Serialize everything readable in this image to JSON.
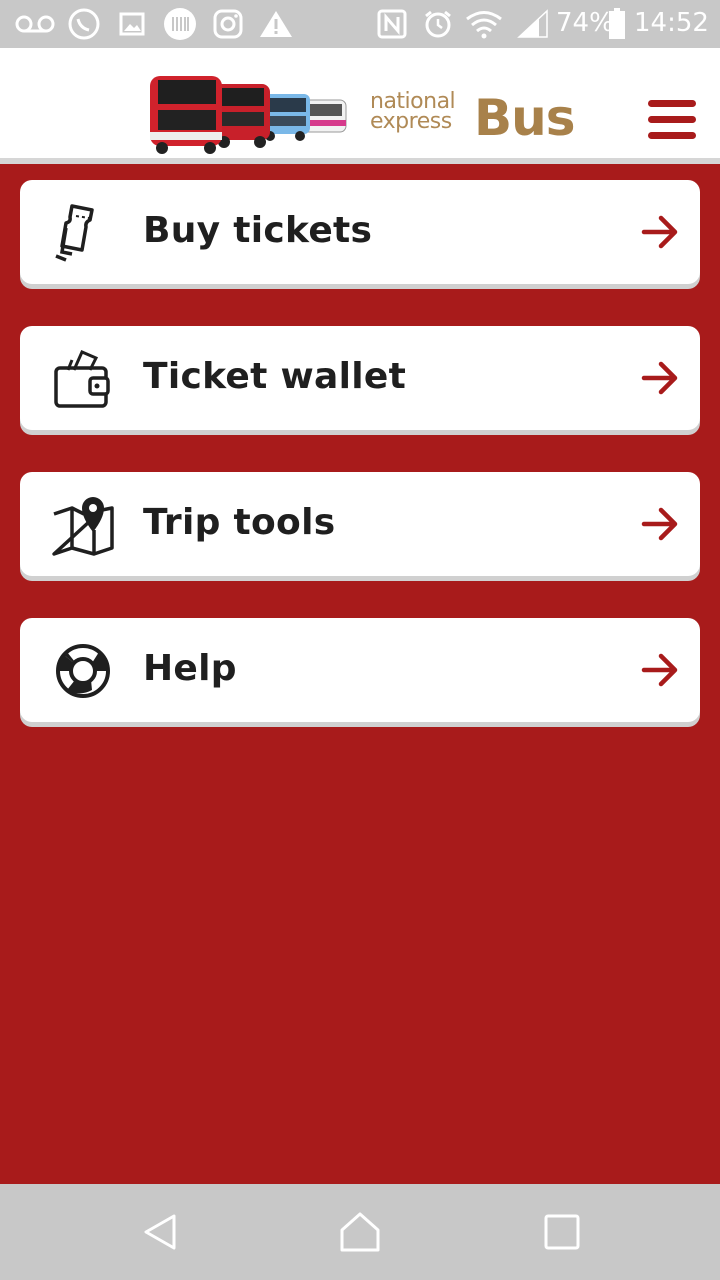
{
  "status_bar": {
    "battery_percent": "74%",
    "time": "14:52",
    "icons": [
      "voicemail-icon",
      "whatsapp-icon",
      "image-icon",
      "barcode-icon",
      "instagram-icon",
      "warning-icon",
      "nfc-icon",
      "alarm-icon",
      "wifi-icon",
      "signal-icon",
      "battery-icon"
    ]
  },
  "header": {
    "logo_line1": "national",
    "logo_line2": "express",
    "logo_bus": "Bus",
    "brand_color": "#a81b1b",
    "logo_gold": "#a8814a"
  },
  "menu": {
    "items": [
      {
        "label": "Buy tickets",
        "icon": "ticket-icon"
      },
      {
        "label": "Ticket wallet",
        "icon": "wallet-icon"
      },
      {
        "label": "Trip tools",
        "icon": "map-pin-icon"
      },
      {
        "label": "Help",
        "icon": "lifebuoy-icon"
      }
    ]
  },
  "nav_bar": {
    "buttons": [
      "back-icon",
      "home-icon",
      "recents-icon"
    ]
  }
}
